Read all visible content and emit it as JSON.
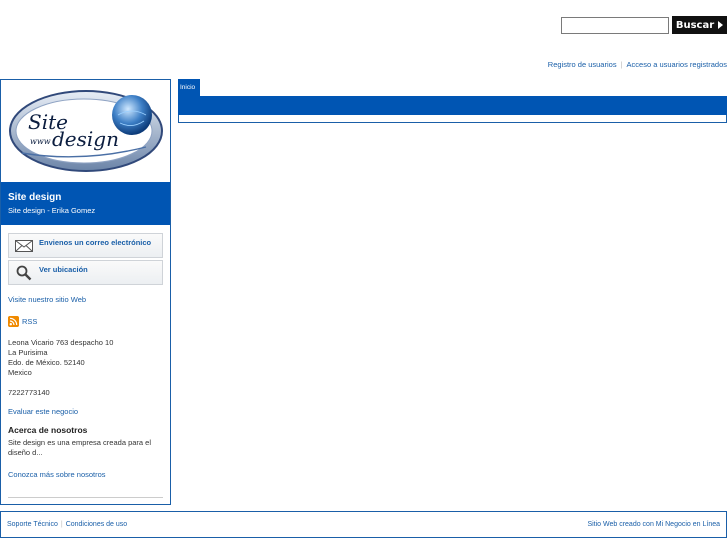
{
  "header": {
    "search": {
      "placeholder": "",
      "value": "",
      "button_label": "Buscar"
    },
    "user_links": [
      "Registro de usuarios",
      "Acceso a usuarios registrados"
    ]
  },
  "nav": {
    "tabs": [
      "Inicio"
    ]
  },
  "sidebar": {
    "logo": {
      "line1": "Site",
      "line2": "www",
      "line3": "design"
    },
    "site_title": "Site design",
    "site_subtitle": "Site design - Erika Gomez",
    "actions": [
      {
        "label": "Envienos un correo electrónico",
        "icon": "envelope-icon"
      },
      {
        "label": "Ver ubicación",
        "icon": "magnifier-icon"
      }
    ],
    "visit_link": "Visite nuestro sitio Web",
    "rss_label": "RSS",
    "address": [
      "Leona Vicario 763 despacho 10",
      "La Purisima",
      "Edo. de México. 52140",
      "Mexico"
    ],
    "phone": "7222773140",
    "evaluate_link": "Evaluar este negocio",
    "about": {
      "title": "Acerca de nosotros",
      "body": "Site design es una empresa creada para el diseño d...",
      "more_link": "Conozca más sobre nosotros"
    }
  },
  "footer": {
    "links": [
      "Soporte Técnico",
      "Condiciones de uso"
    ],
    "credit": "Sitio Web creado con Mi Negocio en Línea"
  },
  "colors": {
    "brand_blue": "#0055b3",
    "link_blue": "#1a5fa8",
    "rss_orange": "#f08a00"
  }
}
